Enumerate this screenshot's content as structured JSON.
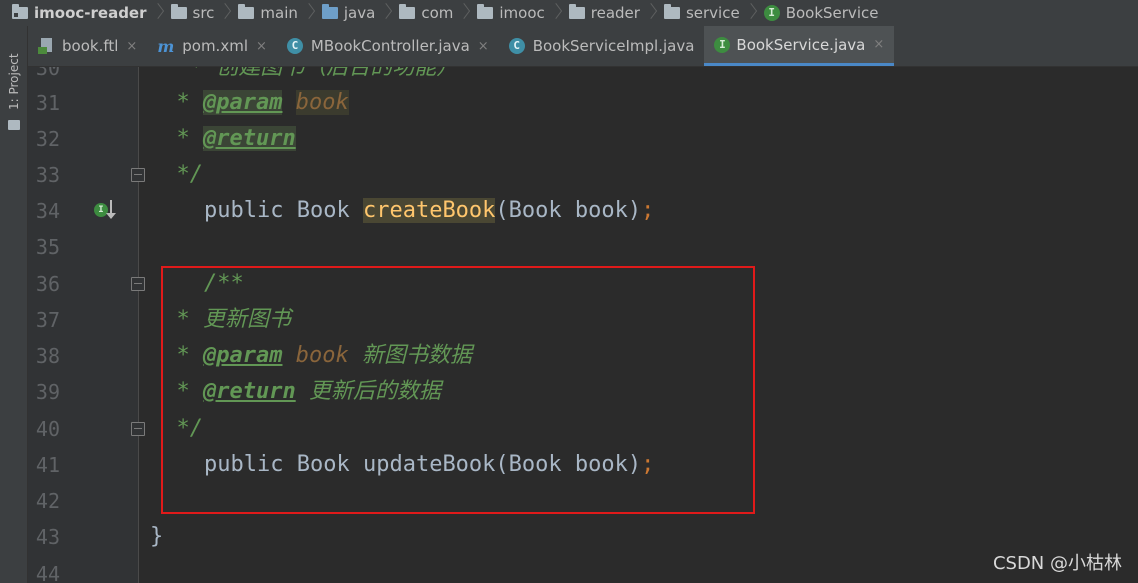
{
  "breadcrumb": [
    {
      "label": "imooc-reader",
      "icon": "project-folder-icon",
      "bold": true
    },
    {
      "label": "src",
      "icon": "folder-icon"
    },
    {
      "label": "main",
      "icon": "folder-icon"
    },
    {
      "label": "java",
      "icon": "source-folder-icon"
    },
    {
      "label": "com",
      "icon": "package-icon"
    },
    {
      "label": "imooc",
      "icon": "package-icon"
    },
    {
      "label": "reader",
      "icon": "package-icon"
    },
    {
      "label": "service",
      "icon": "package-icon"
    },
    {
      "label": "BookService",
      "icon": "interface-icon"
    }
  ],
  "tool_strip": {
    "project_label": "1: Project"
  },
  "tabs": [
    {
      "label": "book.ftl",
      "icon": "ftl-file-icon",
      "active": false
    },
    {
      "label": "pom.xml",
      "icon": "maven-icon",
      "icon_glyph": "m",
      "active": false
    },
    {
      "label": "MBookController.java",
      "icon": "class-icon",
      "icon_glyph": "C",
      "active": false
    },
    {
      "label": "BookServiceImpl.java",
      "icon": "class-icon",
      "icon_glyph": "C",
      "active": false
    },
    {
      "label": "BookService.java",
      "icon": "interface-icon",
      "icon_glyph": "I",
      "active": true
    }
  ],
  "tab_close_glyph": "×",
  "editor": {
    "lines": [
      {
        "num": "30",
        "text": "   * 创建图书（后台的功能）"
      },
      {
        "num": "31"
      },
      {
        "num": "32"
      },
      {
        "num": "33"
      },
      {
        "num": "34"
      },
      {
        "num": "35"
      },
      {
        "num": "36"
      },
      {
        "num": "37"
      },
      {
        "num": "38"
      },
      {
        "num": "39"
      },
      {
        "num": "40"
      },
      {
        "num": "41"
      },
      {
        "num": "42"
      },
      {
        "num": "43"
      },
      {
        "num": "44"
      }
    ],
    "code": {
      "l31_star": "  * ",
      "l31_tag": "@param",
      "l31_sp": " ",
      "l31_param": "book",
      "l32_star": "  * ",
      "l32_tag": "@return",
      "l33_close": "  */",
      "l34_kw": "public",
      "l34_type": "Book",
      "l34_method": "createBook",
      "l34_open": "(",
      "l34_ptype": "Book",
      "l34_pname": "book",
      "l34_close": ")",
      "l34_semi": ";",
      "l36_open": "/**",
      "l37_text": "  * 更新图书",
      "l38_star": "  * ",
      "l38_tag": "@param",
      "l38_param": "book",
      "l38_desc": " 新图书数据",
      "l39_star": "  * ",
      "l39_tag": "@return",
      "l39_desc": " 更新后的数据",
      "l40_close": "  */",
      "l41_kw": "public",
      "l41_type": "Book",
      "l41_method": "updateBook",
      "l41_open": "(",
      "l41_ptype": "Book",
      "l41_pname": "book",
      "l41_close": ")",
      "l41_semi": ";",
      "l43_brace": "}"
    }
  },
  "watermark": "CSDN @小枯林",
  "colors": {
    "background": "#2b2b2b",
    "doc_comment": "#629755",
    "param_name": "#8a653b",
    "method_decl": "#ffc66d",
    "semicolon": "#cc7832",
    "highlight_box": "#e01a1a",
    "active_tab_underline": "#4a88c7"
  }
}
